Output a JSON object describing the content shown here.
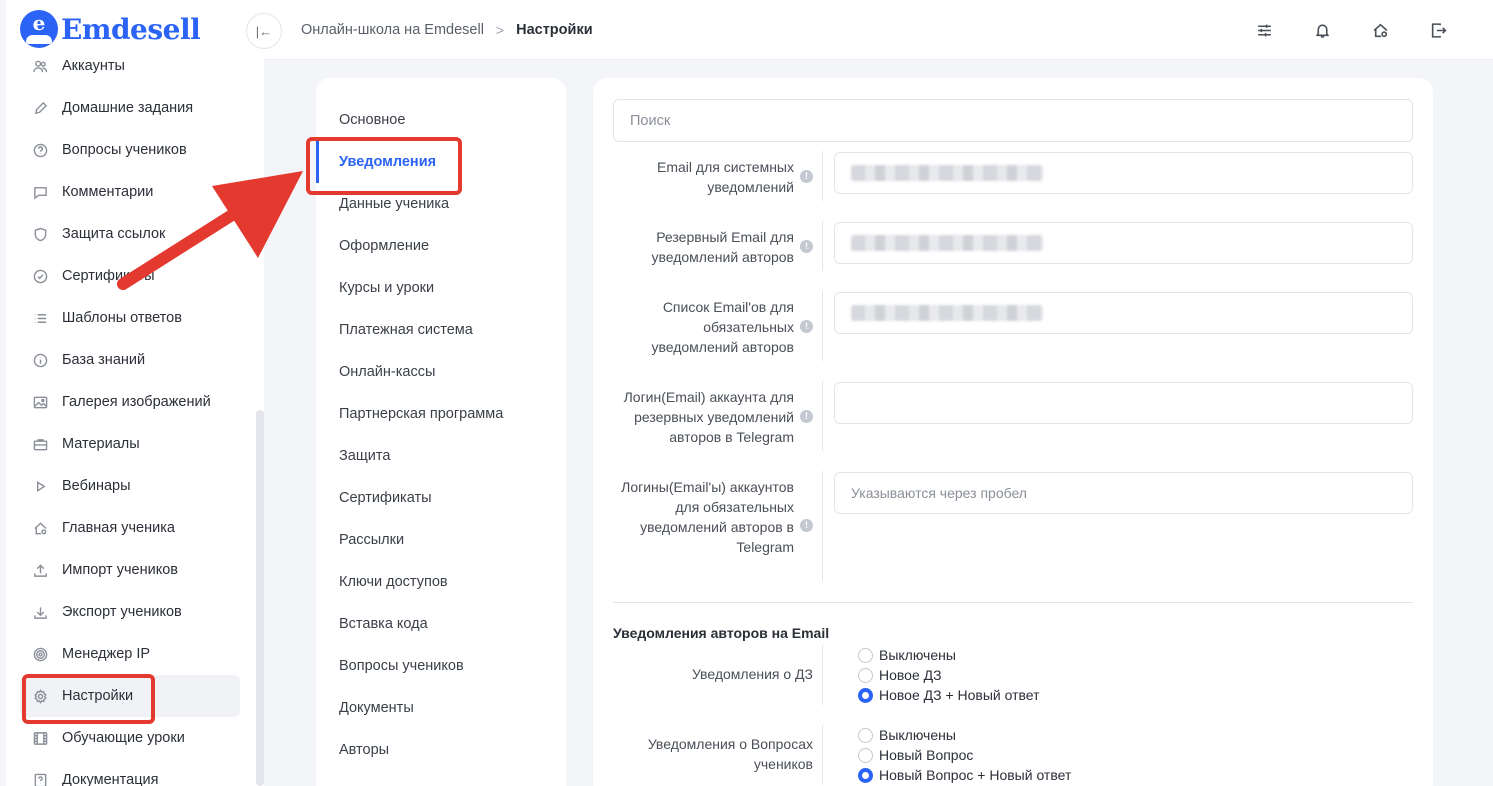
{
  "app": {
    "logo_text": "Emdesell",
    "logo_letter": "e"
  },
  "sidebar": {
    "items": [
      {
        "label": "Аккаунты",
        "icon": "users-icon"
      },
      {
        "label": "Домашние задания",
        "icon": "pencil-icon"
      },
      {
        "label": "Вопросы учеников",
        "icon": "question-icon"
      },
      {
        "label": "Комментарии",
        "icon": "comment-icon"
      },
      {
        "label": "Защита ссылок",
        "icon": "shield-icon"
      },
      {
        "label": "Сертификаты",
        "icon": "badge-check-icon"
      },
      {
        "label": "Шаблоны ответов",
        "icon": "list-icon"
      },
      {
        "label": "База знаний",
        "icon": "info-icon"
      },
      {
        "label": "Галерея изображений",
        "icon": "image-icon"
      },
      {
        "label": "Материалы",
        "icon": "briefcase-icon"
      },
      {
        "label": "Вебинары",
        "icon": "play-icon"
      },
      {
        "label": "Главная ученика",
        "icon": "home-settings-icon"
      },
      {
        "label": "Импорт учеников",
        "icon": "upload-icon"
      },
      {
        "label": "Экспорт учеников",
        "icon": "download-icon"
      },
      {
        "label": "Менеджер IP",
        "icon": "target-icon"
      },
      {
        "label": "Настройки",
        "icon": "gear-icon",
        "active": true
      },
      {
        "label": "Обучающие уроки",
        "icon": "film-icon"
      },
      {
        "label": "Документация",
        "icon": "doc-question-icon"
      }
    ]
  },
  "header": {
    "breadcrumb_root": "Онлайн-школа на Emdesell",
    "breadcrumb_current": "Настройки",
    "icons": [
      "sliders-icon",
      "bell-icon",
      "home-gear-icon",
      "logout-icon"
    ]
  },
  "settings_menu": {
    "items": [
      "Основное",
      "Уведомления",
      "Данные ученика",
      "Оформление",
      "Курсы и уроки",
      "Платежная система",
      "Онлайн-кассы",
      "Партнерская программа",
      "Защита",
      "Сертификаты",
      "Рассылки",
      "Ключи доступов",
      "Вставка кода",
      "Вопросы учеников",
      "Документы",
      "Авторы"
    ],
    "active_index": 1
  },
  "form": {
    "search_placeholder": "Поиск",
    "fields": [
      {
        "label": "Email для системных уведомлений",
        "value_hidden": true
      },
      {
        "label": "Резервный Email для уведомлений авторов",
        "value_hidden": true
      },
      {
        "label": "Список Email'ов для обязательных уведомлений авторов",
        "value_hidden": true
      },
      {
        "label": "Логин(Email) аккаунта для резервных уведомлений авторов в Telegram",
        "value": ""
      },
      {
        "label": "Логины(Email'ы) аккаунтов для обязательных уведомлений авторов в Telegram",
        "placeholder": "Указываются через пробел"
      }
    ],
    "info_mark": "!",
    "section_title": "Уведомления авторов на Email",
    "radio_groups": [
      {
        "label": "Уведомления о ДЗ",
        "options": [
          "Выключены",
          "Новое ДЗ",
          "Новое ДЗ + Новый ответ"
        ],
        "selected": 2
      },
      {
        "label": "Уведомления о Вопросах учеников",
        "options": [
          "Выключены",
          "Новый Вопрос",
          "Новый Вопрос + Новый ответ"
        ],
        "selected": 2
      }
    ]
  },
  "colors": {
    "accent": "#2a63f5",
    "annotation": "#e4392f"
  }
}
